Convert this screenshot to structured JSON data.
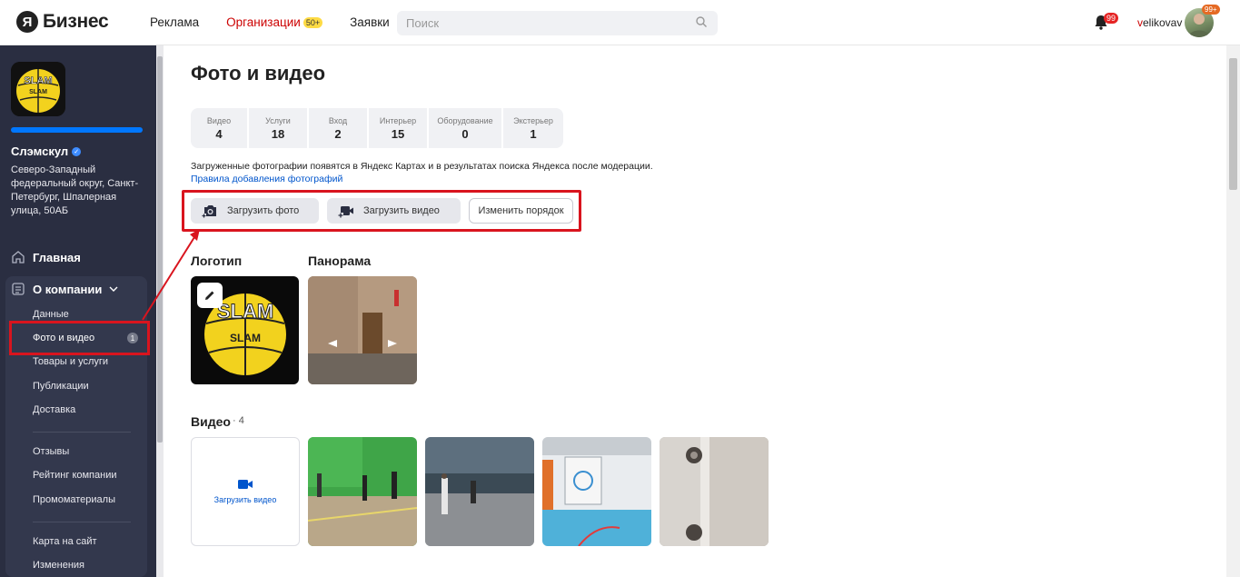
{
  "header": {
    "logo_mark": "Я",
    "logo_text": "Бизнес",
    "nav": [
      {
        "label": "Реклама"
      },
      {
        "label": "Организации",
        "badge": "50+"
      },
      {
        "label": "Заявки"
      }
    ],
    "search_placeholder": "Поиск",
    "notifications_badge": "99",
    "username_first": "v",
    "username_rest": "elikovav",
    "avatar_badge": "99+"
  },
  "sidebar": {
    "company_name": "Слэмскул",
    "company_address": "Северо-Западный федеральный округ, Санкт-Петербург, Шпалерная улица, 50АБ",
    "main_label": "Главная",
    "about_label": "О компании",
    "about_items": [
      {
        "label": "Данные"
      },
      {
        "label": "Фото и видео",
        "badge": "1"
      },
      {
        "label": "Товары и услуги"
      },
      {
        "label": "Публикации"
      },
      {
        "label": "Доставка"
      }
    ],
    "group2": [
      {
        "label": "Отзывы"
      },
      {
        "label": "Рейтинг компании"
      },
      {
        "label": "Промоматериалы"
      }
    ],
    "group3": [
      {
        "label": "Карта на сайт"
      },
      {
        "label": "Изменения"
      }
    ]
  },
  "main": {
    "title": "Фото и видео",
    "stats": [
      {
        "label": "Видео",
        "value": "4"
      },
      {
        "label": "Услуги",
        "value": "18"
      },
      {
        "label": "Вход",
        "value": "2"
      },
      {
        "label": "Интерьер",
        "value": "15"
      },
      {
        "label": "Оборудование",
        "value": "0"
      },
      {
        "label": "Экстерьер",
        "value": "1"
      }
    ],
    "notice": "Загруженные фотографии появятся в Яндекс Картах и в результатах поиска Яндекса после модерации.",
    "rules_link": "Правила добавления фотографий",
    "upload_photo": "Загрузить фото",
    "upload_video": "Загрузить видео",
    "change_order": "Изменить порядок",
    "logo_section": "Логотип",
    "panorama_section": "Панорама",
    "video_section": "Видео",
    "video_count": "4",
    "upload_video_tile": "Загрузить видео"
  },
  "colors": {
    "sidebar_bg": "#2a2e41",
    "accent_blue": "#0077ff",
    "highlight_red": "#d9141e",
    "active_nav_red": "#cc0000"
  }
}
